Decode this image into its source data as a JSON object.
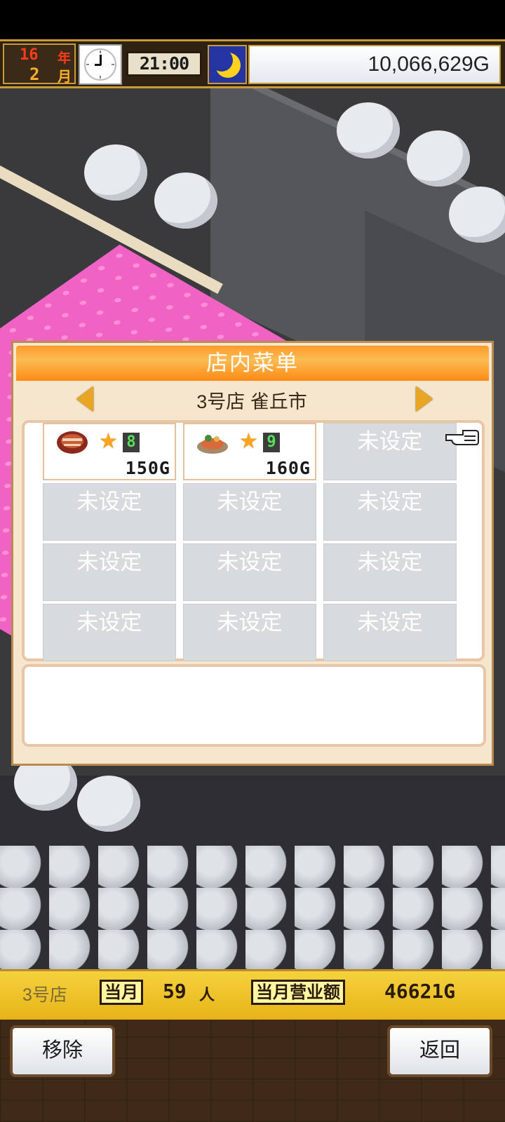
{
  "hud": {
    "year_value": "16",
    "year_label": "年",
    "month_value": "2",
    "month_label": "月",
    "time": "21:00",
    "money": "10,066,629G"
  },
  "dialog": {
    "title": "店内菜单",
    "store_label": "3号店 雀丘市",
    "slots": [
      {
        "rank": "8",
        "price": "150G",
        "empty": false
      },
      {
        "rank": "9",
        "price": "160G",
        "empty": false
      },
      {
        "label": "未设定",
        "empty": true
      },
      {
        "label": "未设定",
        "empty": true
      },
      {
        "label": "未设定",
        "empty": true
      },
      {
        "label": "未设定",
        "empty": true
      },
      {
        "label": "未设定",
        "empty": true
      },
      {
        "label": "未设定",
        "empty": true
      },
      {
        "label": "未设定",
        "empty": true
      },
      {
        "label": "未设定",
        "empty": true
      },
      {
        "label": "未设定",
        "empty": true
      },
      {
        "label": "未设定",
        "empty": true
      }
    ],
    "info_text": ""
  },
  "bottom_bar": {
    "store": "3号店",
    "month_tag": "当月",
    "visitors": "59",
    "visitors_unit": "人",
    "sales_tag": "当月营业额",
    "sales": "46621G"
  },
  "buttons": {
    "remove": "移除",
    "back": "返回"
  },
  "colors": {
    "title_orange": "#ff8a14",
    "star": "#ffa51e",
    "floor_pink": "#f062c4",
    "bar_yellow": "#f4d23e"
  }
}
